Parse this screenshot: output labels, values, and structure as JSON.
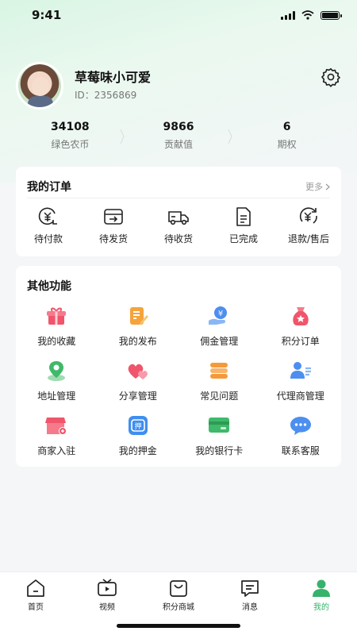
{
  "status": {
    "time": "9:41"
  },
  "profile": {
    "username": "草莓味小可爱",
    "id_text": "ID：2356869"
  },
  "stats": [
    {
      "value": "34108",
      "label": "绿色农币"
    },
    {
      "value": "9866",
      "label": "贡献值"
    },
    {
      "value": "6",
      "label": "期权"
    }
  ],
  "orders": {
    "title": "我的订单",
    "more": "更多",
    "items": [
      {
        "label": "待付款",
        "icon": "yen-wallet-icon"
      },
      {
        "label": "待发货",
        "icon": "box-arrow-icon"
      },
      {
        "label": "待收货",
        "icon": "truck-icon"
      },
      {
        "label": "已完成",
        "icon": "document-icon"
      },
      {
        "label": "退款/售后",
        "icon": "yen-refund-icon"
      }
    ]
  },
  "functions": {
    "title": "其他功能",
    "items": [
      {
        "label": "我的收藏",
        "icon": "gift-icon",
        "color": "#f0556b"
      },
      {
        "label": "我的发布",
        "icon": "edit-note-icon",
        "color": "#f5a33b"
      },
      {
        "label": "佣金管理",
        "icon": "hand-coin-icon",
        "color": "#4c8ff0"
      },
      {
        "label": "积分订单",
        "icon": "money-bag-icon",
        "color": "#f0556b"
      },
      {
        "label": "地址管理",
        "icon": "location-pin-icon",
        "color": "#3fb96a"
      },
      {
        "label": "分享管理",
        "icon": "hearts-icon",
        "color": "#f0556b"
      },
      {
        "label": "常见问题",
        "icon": "stack-icon",
        "color": "#f59a3b"
      },
      {
        "label": "代理商管理",
        "icon": "person-list-icon",
        "color": "#4c8ff0"
      },
      {
        "label": "商家入驻",
        "icon": "store-icon",
        "color": "#f0556b"
      },
      {
        "label": "我的押金",
        "icon": "deposit-icon",
        "color": "#3f8ef0"
      },
      {
        "label": "我的银行卡",
        "icon": "bank-card-icon",
        "color": "#3fb96a"
      },
      {
        "label": "联系客服",
        "icon": "chat-bubble-icon",
        "color": "#4c8ff0"
      }
    ]
  },
  "tabs": [
    {
      "label": "首页",
      "icon": "home-icon"
    },
    {
      "label": "视频",
      "icon": "tv-icon"
    },
    {
      "label": "积分商城",
      "icon": "shopping-bag-icon"
    },
    {
      "label": "消息",
      "icon": "message-icon"
    },
    {
      "label": "我的",
      "icon": "profile-icon",
      "active": true
    }
  ],
  "colors": {
    "accent": "#35b36b",
    "background": "#f4f6f8"
  }
}
